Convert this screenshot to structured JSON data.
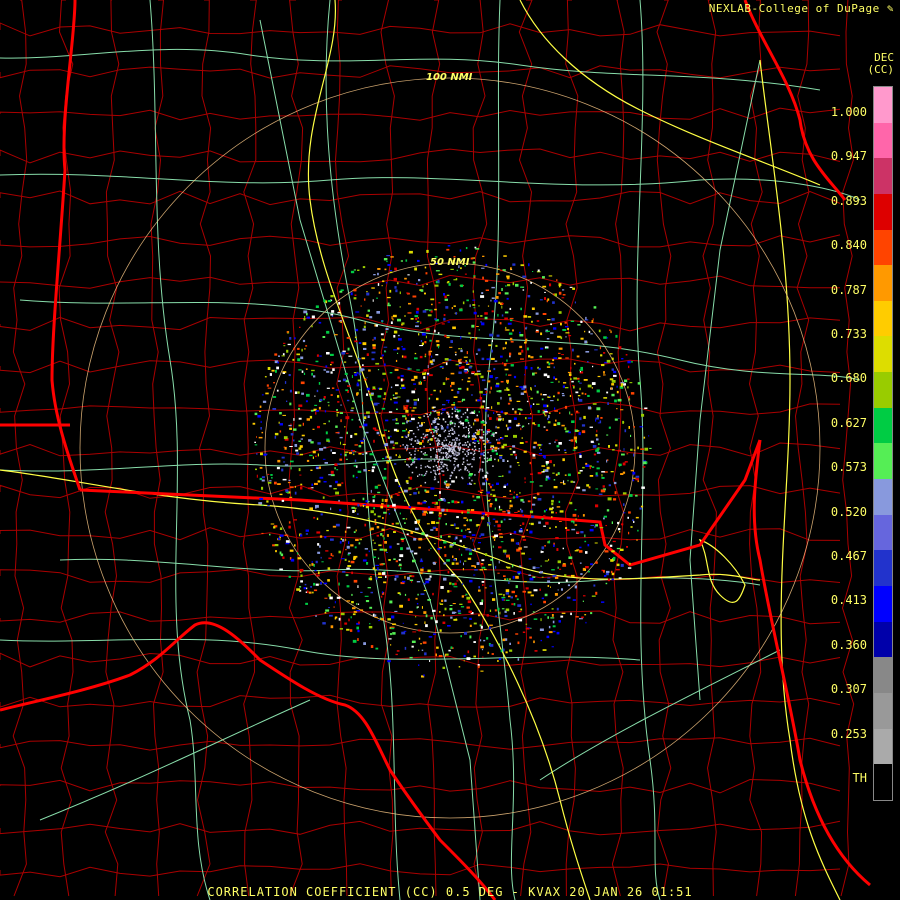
{
  "header": {
    "credit": "NEXLAB-College of DuPage",
    "credit_icon": "pen-icon",
    "product_code_top": "DEC",
    "product_code_bottom": "(CC)"
  },
  "range_rings": [
    {
      "label": "100 NMI"
    },
    {
      "label": "50 NMI"
    }
  ],
  "legend": {
    "ticks": [
      "1.000",
      "0.947",
      "0.893",
      "0.840",
      "0.787",
      "0.733",
      "0.680",
      "0.627",
      "0.573",
      "0.520",
      "0.467",
      "0.413",
      "0.360",
      "0.307",
      "0.253",
      "TH"
    ],
    "colors": [
      "#ff99cc",
      "#ff66aa",
      "#cc3366",
      "#dd0000",
      "#ff4400",
      "#ff9900",
      "#ffcc00",
      "#dddd00",
      "#99cc00",
      "#00cc44",
      "#55ee55",
      "#8899dd",
      "#6666dd",
      "#2233cc",
      "#0000ff",
      "#0000aa",
      "#888888",
      "#999999",
      "#aaaaaa",
      "#000000"
    ]
  },
  "colors": {
    "background": "#000000",
    "state_border": "#ff0000",
    "county_border": "#aa0000",
    "highway": "#ffff44",
    "road": "#88ddaa",
    "range_ring": "#ffcc88",
    "text": "#ffff66"
  },
  "caption": "CORRELATION COEFFICIENT (CC) 0.5 DEG - KVAX 20 JAN 26 01:51"
}
